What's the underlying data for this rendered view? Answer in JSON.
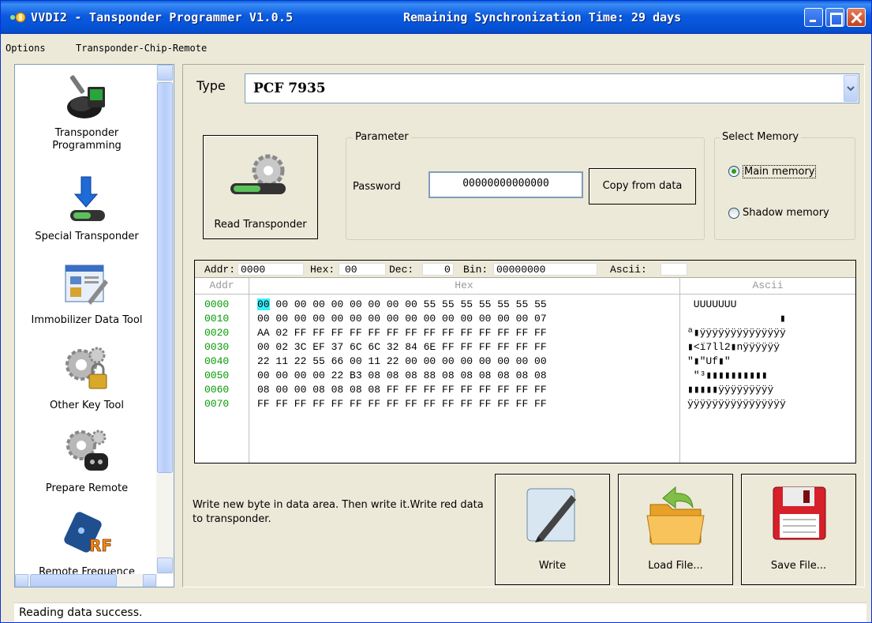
{
  "window": {
    "title": "VVDI2 - Tansponder Programmer V1.0.5",
    "sync": "Remaining Synchronization Time: 29 days"
  },
  "menu": [
    "Options",
    "Transponder-Chip-Remote"
  ],
  "sidebar": {
    "items": [
      {
        "label": "Transponder\nProgramming",
        "icon": "key-laptop-icon"
      },
      {
        "label": "Special Transponder",
        "icon": "transponder-arrow-icon"
      },
      {
        "label": "Immobilizer Data Tool",
        "icon": "window-wrench-icon"
      },
      {
        "label": "Other Key Tool",
        "icon": "gears-lock-icon"
      },
      {
        "label": "Prepare Remote",
        "icon": "gears-remote-icon"
      },
      {
        "label": "Remote Frequence",
        "icon": "rf-remote-icon"
      }
    ]
  },
  "type": {
    "label": "Type",
    "value": "PCF 7935"
  },
  "read_button": "Read Transponder",
  "parameter": {
    "legend": "Parameter",
    "password_label": "Password",
    "password_value": "00000000000000",
    "copy_button": "Copy from data"
  },
  "memory": {
    "legend": "Select Memory",
    "main": "Main memory",
    "shadow": "Shadow memory",
    "selected": "main"
  },
  "info": {
    "addr_label": "Addr:",
    "addr": "0000",
    "hex_label": "Hex:",
    "hex": "00",
    "dec_label": "Dec:",
    "dec": "0",
    "bin_label": "Bin:",
    "bin": "00000000",
    "ascii_label": "Ascii:",
    "ascii": ""
  },
  "columns": {
    "addr": "Addr",
    "hex": "Hex",
    "ascii": "Ascii"
  },
  "rows": [
    {
      "addr": "0000",
      "hex": "00 00 00 00 00 00 00 00 00 55 55 55 55 55 55 55",
      "ascii": " UUUUUUU"
    },
    {
      "addr": "0010",
      "hex": "00 00 00 00 00 00 00 00 00 00 00 00 00 00 00 07",
      "ascii": "               ▮"
    },
    {
      "addr": "0020",
      "hex": "AA 02 FF FF FF FF FF FF FF FF FF FF FF FF FF FF",
      "ascii": "ª▮ÿÿÿÿÿÿÿÿÿÿÿÿÿÿ"
    },
    {
      "addr": "0030",
      "hex": "00 02 3C EF 37 6C 6C 32 84 6E FF FF FF FF FF FF",
      "ascii": "▮<ï7ll2▮nÿÿÿÿÿÿ"
    },
    {
      "addr": "0040",
      "hex": "22 11 22 55 66 00 11 22 00 00 00 00 00 00 00 00",
      "ascii": "\"▮\"Uf▮\""
    },
    {
      "addr": "0050",
      "hex": "00 00 00 00 22 B3 08 08 08 88 08 08 08 08 08 08",
      "ascii": " \"³▮▮▮▮▮▮▮▮▮▮"
    },
    {
      "addr": "0060",
      "hex": "08 00 00 08 08 08 08 FF FF FF FF FF FF FF FF FF",
      "ascii": "▮▮▮▮▮ÿÿÿÿÿÿÿÿÿ"
    },
    {
      "addr": "0070",
      "hex": "FF FF FF FF FF FF FF FF FF FF FF FF FF FF FF FF",
      "ascii": "ÿÿÿÿÿÿÿÿÿÿÿÿÿÿÿÿ"
    }
  ],
  "hint": "Write new byte in data area. Then write it.Write red data to transponder.",
  "buttons": {
    "write": "Write",
    "load": "Load File...",
    "save": "Save File..."
  },
  "status": "Reading data success."
}
